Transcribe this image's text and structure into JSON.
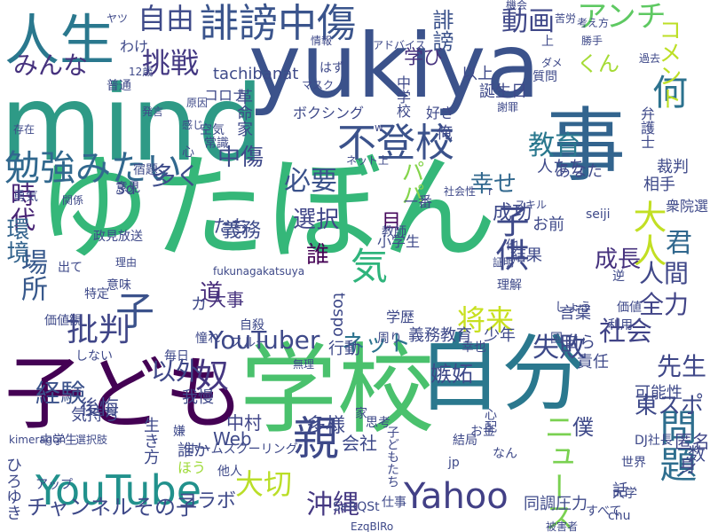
{
  "wordcloud": {
    "words": [
      {
        "text": "ゆたぼん",
        "color": "#35b779"
      },
      {
        "text": "yukiya",
        "color": "#3b528b"
      },
      {
        "text": "mind",
        "color": "#2e9a86"
      },
      {
        "text": "学校",
        "color": "#4ac16d"
      },
      {
        "text": "自分",
        "color": "#2a788e"
      },
      {
        "text": "子ども",
        "color": "#440154"
      },
      {
        "text": "事",
        "color": "#32648e"
      },
      {
        "text": "人生",
        "color": "#2a788e"
      },
      {
        "text": "不登校",
        "color": "#3b528b"
      },
      {
        "text": "誹謗中傷",
        "color": "#3a548c"
      },
      {
        "text": "勉強みたい",
        "color": "#31688e"
      },
      {
        "text": "YouTube",
        "color": "#21918c"
      },
      {
        "text": "問題",
        "color": "#2e6e8e"
      },
      {
        "text": "親",
        "color": "#3e4989"
      },
      {
        "text": "Yahoo",
        "color": "#424086"
      },
      {
        "text": "ニュース",
        "color": "#7ad151"
      },
      {
        "text": "大人",
        "color": "#c2df23"
      },
      {
        "text": "アンチ",
        "color": "#5ec962"
      },
      {
        "text": "自由",
        "color": "#3e4a89"
      },
      {
        "text": "挑戦",
        "color": "#443983"
      },
      {
        "text": "みんな",
        "color": "#46327e"
      },
      {
        "text": "動画",
        "color": "#3f4788"
      },
      {
        "text": "何",
        "color": "#2c728e"
      },
      {
        "text": "教育",
        "color": "#2a788e"
      },
      {
        "text": "必要",
        "color": "#3b528b"
      },
      {
        "text": "多く",
        "color": "#3e4c8a"
      },
      {
        "text": "パパ",
        "color": "#84d44b"
      },
      {
        "text": "幸せ",
        "color": "#31688e"
      },
      {
        "text": "子",
        "color": "#3b528b"
      },
      {
        "text": "批判",
        "color": "#404688"
      },
      {
        "text": "将来",
        "color": "#c8e020"
      },
      {
        "text": "失敗",
        "color": "#3e4a89"
      },
      {
        "text": "社会",
        "color": "#414487"
      },
      {
        "text": "奴",
        "color": "#453781"
      },
      {
        "text": "経験",
        "color": "#3b528b"
      },
      {
        "text": "選択",
        "color": "#404688"
      },
      {
        "text": "中傷",
        "color": "#3e4989"
      },
      {
        "text": "場所",
        "color": "#38598c"
      },
      {
        "text": "時代",
        "color": "#482475"
      },
      {
        "text": "環境",
        "color": "#33638d"
      },
      {
        "text": "気",
        "color": "#2fb47c"
      },
      {
        "text": "YouTuber",
        "color": "#3e4989"
      },
      {
        "text": "以外",
        "color": "#3f4889"
      },
      {
        "text": "先生",
        "color": "#3f4788"
      },
      {
        "text": "コメント",
        "color": "#bddf26"
      },
      {
        "text": "tachibanat",
        "color": "#3e4a89"
      },
      {
        "text": "学び",
        "color": "#46327e"
      },
      {
        "text": "誹謗",
        "color": "#3b528b"
      },
      {
        "text": "くん",
        "color": "#a5db36"
      },
      {
        "text": "大切",
        "color": "#bade28"
      },
      {
        "text": "沖縄",
        "color": "#453882"
      },
      {
        "text": "東スポ",
        "color": "#3e4989"
      },
      {
        "text": "全力",
        "color": "#414487"
      },
      {
        "text": "人間",
        "color": "#3f4788"
      },
      {
        "text": "君",
        "color": "#31688e"
      },
      {
        "text": "成長",
        "color": "#46327e"
      },
      {
        "text": "成功",
        "color": "#3e4989"
      },
      {
        "text": "子供",
        "color": "#3e4989"
      },
      {
        "text": "誰",
        "color": "#440154"
      },
      {
        "text": "道",
        "color": "#472c7a"
      },
      {
        "text": "ネット",
        "color": "#2c738e"
      },
      {
        "text": "義務",
        "color": "#3e4c8a"
      },
      {
        "text": "大事",
        "color": "#46327e"
      },
      {
        "text": "目",
        "color": "#46085c"
      },
      {
        "text": "Web",
        "color": "#3e4989"
      },
      {
        "text": "中村",
        "color": "#404588"
      },
      {
        "text": "多様",
        "color": "#3e4989"
      },
      {
        "text": "僕",
        "color": "#3e4989"
      },
      {
        "text": "嫉妬",
        "color": "#3e4989"
      },
      {
        "text": "身",
        "color": "#3f4788"
      },
      {
        "text": "数",
        "color": "#3e4989"
      },
      {
        "text": "匿名",
        "color": "#404688"
      },
      {
        "text": "会社",
        "color": "#3e4989"
      },
      {
        "text": "コラボ",
        "color": "#3e4989"
      },
      {
        "text": "チャンネル",
        "color": "#3e4989"
      },
      {
        "text": "その子",
        "color": "#3e4989"
      },
      {
        "text": "同調圧力",
        "color": "#3e4989"
      },
      {
        "text": "話",
        "color": "#3e4989"
      },
      {
        "text": "後悔",
        "color": "#3e4989"
      },
      {
        "text": "生き方",
        "color": "#3e4989"
      },
      {
        "text": "誰か",
        "color": "#3e4989"
      },
      {
        "text": "ほう",
        "color": "#9fda3a"
      },
      {
        "text": "ひろゆき",
        "color": "#3e4989"
      },
      {
        "text": "我慢",
        "color": "#3e4989"
      },
      {
        "text": "気持ち",
        "color": "#3e4989"
      },
      {
        "text": "少年",
        "color": "#3e4989"
      },
      {
        "text": "可能性",
        "color": "#3e4989"
      },
      {
        "text": "責任",
        "color": "#3e4989"
      },
      {
        "text": "自ら",
        "color": "#3e4989"
      },
      {
        "text": "言葉",
        "color": "#3e4989"
      },
      {
        "text": "お前",
        "color": "#3e4989"
      },
      {
        "text": "相手",
        "color": "#3e4989"
      },
      {
        "text": "裁判",
        "color": "#3e4989"
      },
      {
        "text": "衆院選",
        "color": "#3e4989"
      },
      {
        "text": "弁護士",
        "color": "#3e4989"
      },
      {
        "text": "結果",
        "color": "#3e4989"
      },
      {
        "text": "あなた",
        "color": "#3e4989"
      },
      {
        "text": "人たち",
        "color": "#3e4989"
      },
      {
        "text": "一番",
        "color": "#3e4989"
      },
      {
        "text": "中学校",
        "color": "#3e4989"
      },
      {
        "text": "革命家",
        "color": "#3e4989"
      },
      {
        "text": "誕生日",
        "color": "#3e4989"
      },
      {
        "text": "以上",
        "color": "#3e4989"
      },
      {
        "text": "俺",
        "color": "#3e4989"
      },
      {
        "text": "好き",
        "color": "#3e4989"
      },
      {
        "text": "たち",
        "color": "#3e4989"
      },
      {
        "text": "3d",
        "color": "#3e4989"
      },
      {
        "text": "行動",
        "color": "#3e4989"
      },
      {
        "text": "tospo",
        "color": "#3e4989"
      },
      {
        "text": "義務教育",
        "color": "#3e4989"
      },
      {
        "text": "カ",
        "color": "#3e4989"
      },
      {
        "text": "わけ",
        "color": "#3e4989"
      },
      {
        "text": "はず",
        "color": "#3e4989"
      },
      {
        "text": "マスク",
        "color": "#3e4989"
      },
      {
        "text": "コロナ",
        "color": "#3e4989"
      },
      {
        "text": "ボクシング",
        "color": "#3e4989"
      },
      {
        "text": "上",
        "color": "#3e4989"
      },
      {
        "text": "空気",
        "color": "#3e4989"
      },
      {
        "text": "常識",
        "color": "#3e4989"
      },
      {
        "text": "心",
        "color": "#3e4989"
      },
      {
        "text": "宿題",
        "color": "#3e4989"
      },
      {
        "text": "意見",
        "color": "#3e4989"
      },
      {
        "text": "関係",
        "color": "#3e4989"
      },
      {
        "text": "勇気",
        "color": "#3e4989"
      },
      {
        "text": "政見放送",
        "color": "#3e4989"
      },
      {
        "text": "小学生",
        "color": "#3e4989"
      },
      {
        "text": "教師",
        "color": "#3e4989"
      },
      {
        "text": "学歴",
        "color": "#3e4989"
      },
      {
        "text": "幸也",
        "color": "#3e4989"
      },
      {
        "text": "理解",
        "color": "#3e4989"
      },
      {
        "text": "周り",
        "color": "#3e4989"
      },
      {
        "text": "特定",
        "color": "#3e4989"
      },
      {
        "text": "価値観",
        "color": "#3e4989"
      },
      {
        "text": "自殺",
        "color": "#3e4989"
      },
      {
        "text": "毎日",
        "color": "#3e4989"
      },
      {
        "text": "意味",
        "color": "#3e4989"
      },
      {
        "text": "スルー",
        "color": "#3e4989"
      },
      {
        "text": "家",
        "color": "#3e4989"
      },
      {
        "text": "思考",
        "color": "#3e4989"
      },
      {
        "text": "心配",
        "color": "#3e4989"
      },
      {
        "text": "子どもたち",
        "color": "#3e4989"
      },
      {
        "text": "仕事",
        "color": "#3e4989"
      },
      {
        "text": "お金",
        "color": "#3e4989"
      },
      {
        "text": "他人",
        "color": "#3e4989"
      },
      {
        "text": "SeRQSt",
        "color": "#3e4989"
      },
      {
        "text": "jp",
        "color": "#3e4989"
      },
      {
        "text": "chu",
        "color": "#3e4989"
      },
      {
        "text": "EzqBlRo",
        "color": "#3e4989"
      },
      {
        "text": "kimeragon",
        "color": "#3e4989"
      },
      {
        "text": "fukunagakatsuya",
        "color": "#3e4989"
      },
      {
        "text": "seiji",
        "color": "#3e4989"
      },
      {
        "text": "DJ社長",
        "color": "#3e4989"
      },
      {
        "text": "価値",
        "color": "#3e4989"
      },
      {
        "text": "利用",
        "color": "#3e4989"
      },
      {
        "text": "国",
        "color": "#3e4989"
      },
      {
        "text": "他",
        "color": "#3e4989"
      },
      {
        "text": "しょう",
        "color": "#3e4989"
      },
      {
        "text": "逆",
        "color": "#3e4989"
      },
      {
        "text": "大学",
        "color": "#3e4989"
      },
      {
        "text": "結局",
        "color": "#3e4989"
      },
      {
        "text": "世界",
        "color": "#3e4989"
      },
      {
        "text": "すべて",
        "color": "#3e4989"
      },
      {
        "text": "被害者",
        "color": "#3e4989"
      },
      {
        "text": "なん",
        "color": "#3e4989"
      },
      {
        "text": "ホームスクーリング",
        "color": "#3e4989"
      },
      {
        "text": "中学生",
        "color": "#3e4989"
      },
      {
        "text": "アップ",
        "color": "#3e4989"
      },
      {
        "text": "嫌",
        "color": "#3e4989"
      },
      {
        "text": "選択肢",
        "color": "#3e4989"
      },
      {
        "text": "無理",
        "color": "#3e4989"
      },
      {
        "text": "憧れ",
        "color": "#3e4989"
      },
      {
        "text": "しない",
        "color": "#3e4989"
      },
      {
        "text": "出て",
        "color": "#3e4989"
      },
      {
        "text": "理由",
        "color": "#3e4989"
      },
      {
        "text": "r",
        "color": "#3e4989"
      },
      {
        "text": "証明",
        "color": "#3e4989"
      },
      {
        "text": "スキル",
        "color": "#3e4989"
      },
      {
        "text": "社会性",
        "color": "#3e4989"
      },
      {
        "text": "ネット上",
        "color": "#3e4989"
      },
      {
        "text": "謝罪",
        "color": "#3e4989"
      },
      {
        "text": "質問",
        "color": "#3e4989"
      },
      {
        "text": "ダメ",
        "color": "#3e4989"
      },
      {
        "text": "勝手",
        "color": "#3e4989"
      },
      {
        "text": "過去",
        "color": "#3e4989"
      },
      {
        "text": "考え方",
        "color": "#3e4989"
      },
      {
        "text": "機会",
        "color": "#3e4989"
      },
      {
        "text": "苦労",
        "color": "#3e4989"
      },
      {
        "text": "アドバイス",
        "color": "#3e4989"
      },
      {
        "text": "情報",
        "color": "#3e4989"
      },
      {
        "text": "ヤツ",
        "color": "#3e4989"
      },
      {
        "text": "12歳",
        "color": "#3e4989"
      },
      {
        "text": "普通",
        "color": "#3e4989"
      },
      {
        "text": "原因",
        "color": "#3e4989"
      },
      {
        "text": "存在",
        "color": "#3e4989"
      },
      {
        "text": "感じ",
        "color": "#3e4989"
      },
      {
        "text": "発言",
        "color": "#3e4989"
      },
      {
        "text": "w",
        "color": "#3e4989"
      }
    ]
  }
}
